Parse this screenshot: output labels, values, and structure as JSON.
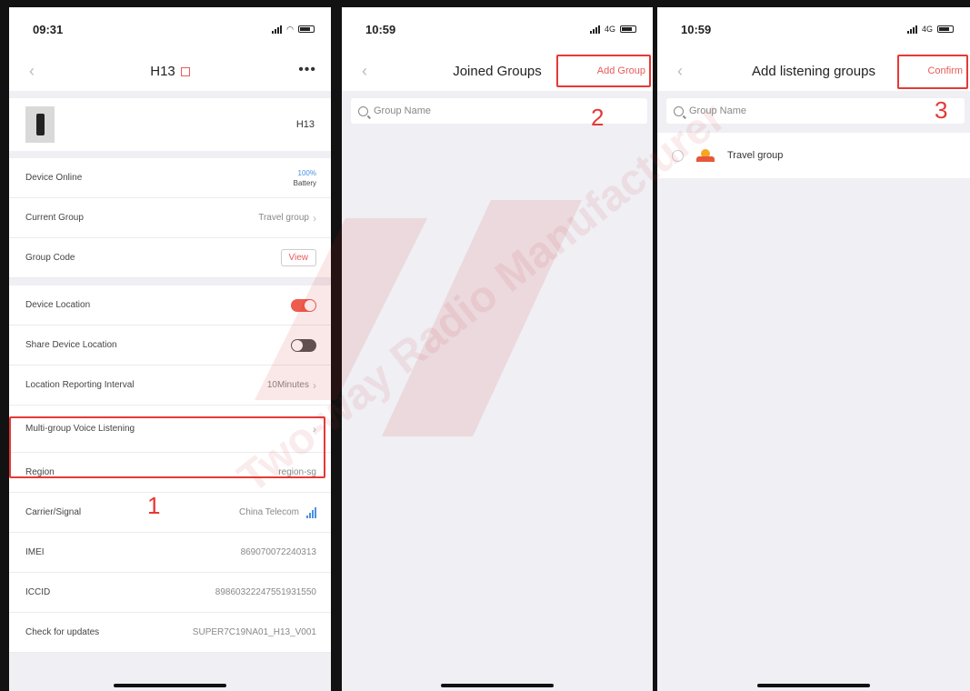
{
  "screen1": {
    "time": "09:31",
    "title": "H13",
    "device_name": "H13",
    "rows": [
      {
        "label": "Device Online",
        "battery_pct": "100%",
        "battery_label": "Battery"
      },
      {
        "label": "Current Group",
        "value": "Travel group"
      },
      {
        "label": "Group Code",
        "button": "View"
      },
      {
        "label": "Device Location",
        "toggle": "on"
      },
      {
        "label": "Share Device Location",
        "toggle": "off"
      },
      {
        "label": "Location Reporting Interval",
        "value": "10Minutes"
      },
      {
        "label": "Multi-group Voice Listening",
        "value": ""
      },
      {
        "label": "Region",
        "value": "region-sg"
      },
      {
        "label": "Carrier/Signal",
        "value": "China Telecom"
      },
      {
        "label": "IMEI",
        "value": "869070072240313"
      },
      {
        "label": "ICCID",
        "value": "89860322247551931550"
      },
      {
        "label": "Check for updates",
        "value": "SUPER7C19NA01_H13_V001"
      }
    ],
    "step": "1"
  },
  "screen2": {
    "time": "10:59",
    "network": "4G",
    "title": "Joined Groups",
    "right_action": "Add Group",
    "search_placeholder": "Group Name",
    "step": "2"
  },
  "screen3": {
    "time": "10:59",
    "network": "4G",
    "title": "Add listening groups",
    "right_action": "Confirm",
    "search_placeholder": "Group Name",
    "group_item": "Travel group",
    "step": "3"
  },
  "watermark": "Two-way Radio Manufacturer",
  "colors": {
    "accent": "#e85a5a",
    "highlight": "#e53935",
    "link": "#4a90e2"
  }
}
